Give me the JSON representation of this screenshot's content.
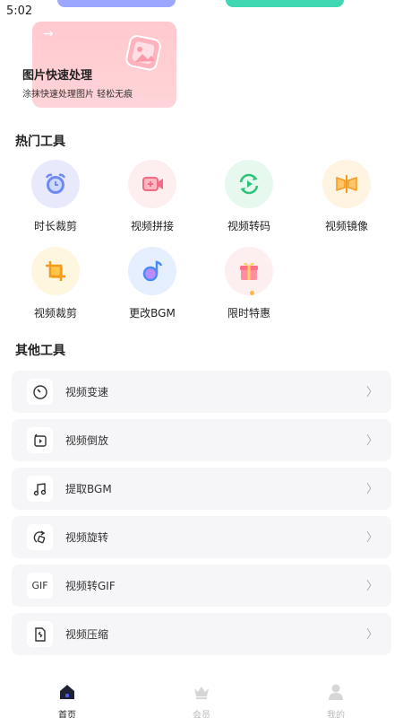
{
  "status_bar": {
    "time": "5:02"
  },
  "promo": {
    "title": "图片快速处理",
    "subtitle": "涂抹快速处理图片 轻松无痕",
    "arrow_glyph": "→"
  },
  "hot_tools": {
    "title": "热门工具",
    "items": [
      {
        "label": "时长裁剪",
        "icon": "alarm-clock-icon",
        "bg": "#e8eafc"
      },
      {
        "label": "视频拼接",
        "icon": "video-camera-plus-icon",
        "bg": "#fdeef0"
      },
      {
        "label": "视频转码",
        "icon": "refresh-play-icon",
        "bg": "#e7f8ef"
      },
      {
        "label": "视频镜像",
        "icon": "mirror-icon",
        "bg": "#fff3e2"
      },
      {
        "label": "视频裁剪",
        "icon": "crop-icon",
        "bg": "#fff6e0"
      },
      {
        "label": "更改BGM",
        "icon": "music-note-icon",
        "bg": "#e6efff"
      },
      {
        "label": "限时特惠",
        "icon": "gift-icon",
        "bg": "#fdeef0"
      }
    ]
  },
  "other_tools": {
    "title": "其他工具",
    "items": [
      {
        "label": "视频变速",
        "icon": "speed-gauge-icon",
        "icon_text": ""
      },
      {
        "label": "视频倒放",
        "icon": "reverse-play-icon",
        "icon_text": ""
      },
      {
        "label": "提取BGM",
        "icon": "music-note-icon",
        "icon_text": ""
      },
      {
        "label": "视频旋转",
        "icon": "rotate-icon",
        "icon_text": ""
      },
      {
        "label": "视频转GIF",
        "icon": "gif-icon",
        "icon_text": "GIF"
      },
      {
        "label": "视频压缩",
        "icon": "compress-file-icon",
        "icon_text": ""
      }
    ],
    "chevron": "〉"
  },
  "bottom_nav": {
    "items": [
      {
        "label": "首页",
        "icon": "home-icon",
        "active": true
      },
      {
        "label": "会员",
        "icon": "crown-icon",
        "active": false
      },
      {
        "label": "我的",
        "icon": "user-icon",
        "active": false
      }
    ]
  },
  "colors": {
    "accent_purple": "#9ba6ff",
    "accent_green": "#3fd8b2",
    "promo_pink": "#ffc9cf",
    "nav_active": "#222222",
    "nav_inactive": "#b8b8b8"
  }
}
